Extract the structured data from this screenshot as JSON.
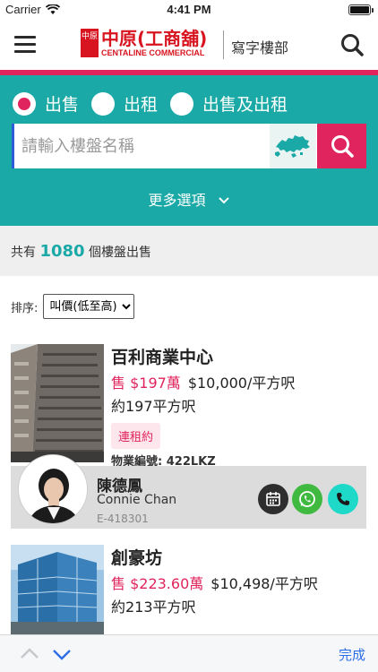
{
  "status": {
    "carrier": "Carrier",
    "time": "4:41 PM"
  },
  "header": {
    "logo_cn": "中原(工商舖)",
    "logo_en": "CENTALINE COMMERCIAL",
    "logo_mark": "中原",
    "department": "寫字樓部"
  },
  "filters": {
    "options": [
      "出售",
      "出租",
      "出售及出租"
    ],
    "selected": "出售",
    "search_placeholder": "請輸入樓盤名稱",
    "more_options": "更多選項"
  },
  "results": {
    "prefix": "共有",
    "count": "1080",
    "suffix": "個樓盤出售"
  },
  "sort": {
    "label": "排序:",
    "selected": "叫價(低至高)"
  },
  "listings": [
    {
      "title": "百利商業中心",
      "price": "售 $197萬",
      "unit_price": "$10,000/平方呎",
      "area": "約197平方呎",
      "badge": "連租約",
      "ref": "物業編號: 422LKZ"
    },
    {
      "title": "創豪坊",
      "price": "售 $223.60萬",
      "unit_price": "$10,498/平方呎",
      "area": "約213平方呎"
    }
  ],
  "agent": {
    "name_cn": "陳德鳳",
    "name_en": "Connie Chan",
    "license": "E-418301"
  },
  "keyboard_bar": {
    "done": "完成"
  },
  "colors": {
    "teal": "#1aa9a6",
    "accent": "#e0245e",
    "brand_red": "#d7141f"
  }
}
